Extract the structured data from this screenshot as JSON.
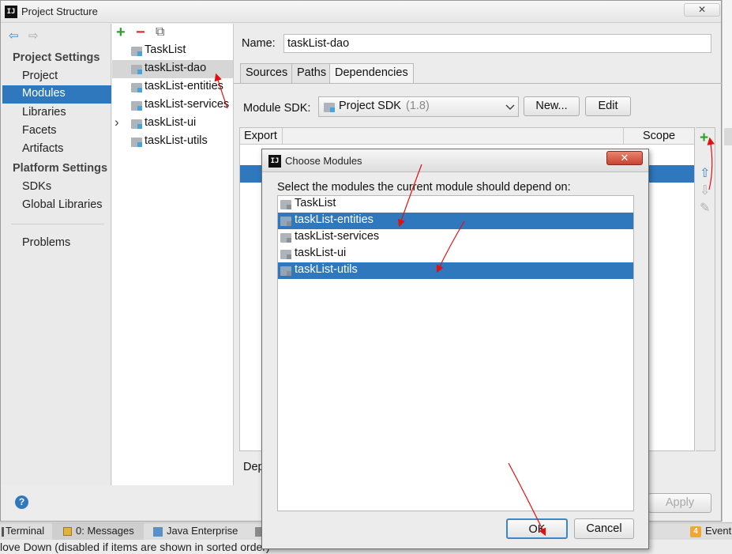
{
  "window": {
    "title": "Project Structure",
    "logo": "IJ",
    "close_glyph": "✕"
  },
  "leftnav": {
    "back_glyph": "⇦",
    "forward_glyph": "⇨",
    "project_settings_header": "Project Settings",
    "project_settings_items": [
      "Project",
      "Modules",
      "Libraries",
      "Facets",
      "Artifacts"
    ],
    "selected_item": "Modules",
    "platform_settings_header": "Platform Settings",
    "platform_settings_items": [
      "SDKs",
      "Global Libraries"
    ],
    "problems_label": "Problems",
    "help_glyph": "?"
  },
  "modules": {
    "toolbar": {
      "add_glyph": "+",
      "remove_glyph": "−",
      "copy_glyph": "⧉"
    },
    "items": [
      "TaskList",
      "taskList-dao",
      "taskList-entities",
      "taskList-services",
      "taskList-ui",
      "taskList-utils"
    ],
    "selected": "taskList-dao",
    "expand_glyph": "›"
  },
  "module_editor": {
    "name_label": "Name:",
    "name_value": "taskList-dao",
    "tabs": [
      "Sources",
      "Paths",
      "Dependencies"
    ],
    "active_tab": "Dependencies",
    "sdk_label": "Module SDK:",
    "sdk_value": "Project SDK",
    "sdk_version": "(1.8)",
    "new_button": "New...",
    "edit_button": "Edit",
    "table": {
      "col_export": "Export",
      "col_scope": "Scope"
    },
    "dep_storage_label": "Dep",
    "apply_button": "Apply",
    "side_tools": {
      "add": "+",
      "up": "⇧",
      "down": "⇩",
      "edit": "✎"
    }
  },
  "dialog": {
    "title": "Choose Modules",
    "logo": "IJ",
    "close_glyph": "✕",
    "prompt": "Select the modules the current module should depend on:",
    "items": [
      {
        "label": "TaskList",
        "selected": false
      },
      {
        "label": "taskList-entities",
        "selected": true
      },
      {
        "label": "taskList-services",
        "selected": false
      },
      {
        "label": "taskList-ui",
        "selected": false
      },
      {
        "label": "taskList-utils",
        "selected": true
      }
    ],
    "ok_button": "OK",
    "cancel_button": "Cancel"
  },
  "bottom_tabs": {
    "terminal": "Terminal",
    "messages": "0: Messages",
    "java_enterprise": "Java Enterprise",
    "event_count": "4",
    "event": "Event"
  },
  "status": {
    "text": "love Down (disabled if items are shown in sorted order)"
  },
  "colors": {
    "selection_blue": "#2f78be",
    "annotation_red": "#e01010",
    "add_green": "#2ea02e",
    "remove_red": "#d12b2b"
  }
}
